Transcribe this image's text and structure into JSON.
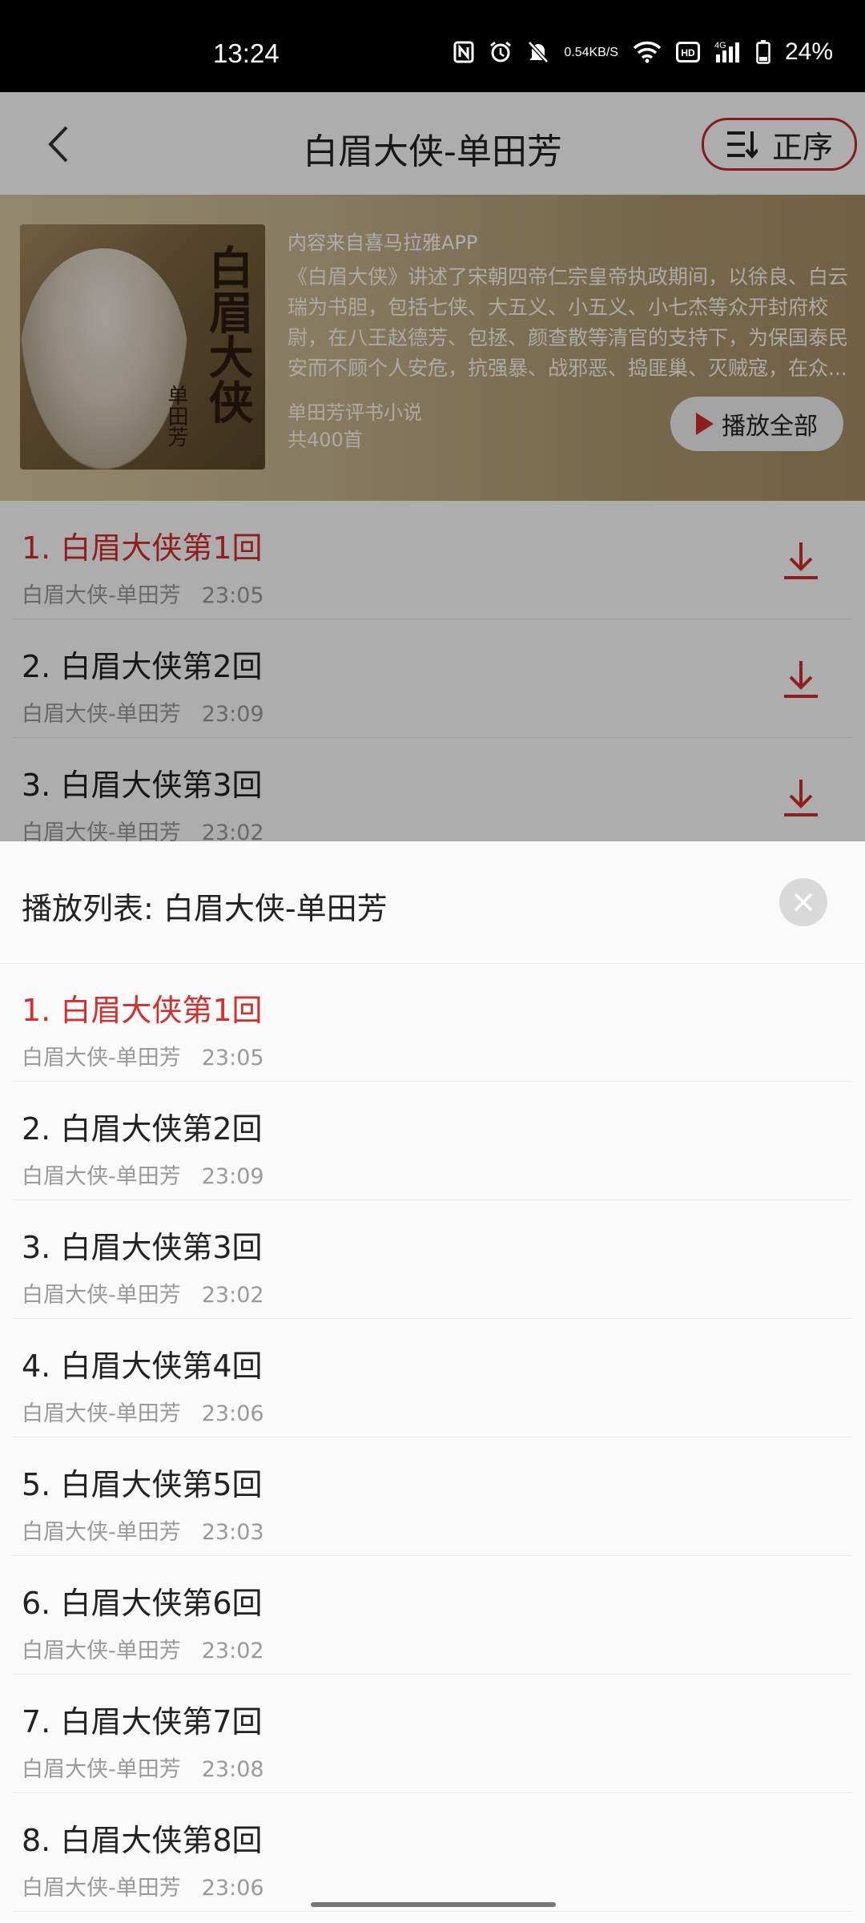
{
  "status_bar": {
    "time": "13:24",
    "net_speed_top": "0.54",
    "net_speed_bottom": "KB/S",
    "network": "4G",
    "battery": "24%"
  },
  "header": {
    "title": "白眉大侠-单田芳",
    "order_label": "正序"
  },
  "album": {
    "source": "内容来自喜马拉雅APP",
    "description": "《白眉大侠》讲述了宋朝四帝仁宗皇帝执政期间，以徐良、白云瑞为书胆，包括七侠、大五义、小五义、小七杰等众开封府校尉，在八王赵德芳、包拯、颜查散等清官的支持下，为保国泰民安而不顾个人安危，抗强暴、战邪恶、捣匪巢、灭贼寇，在众...",
    "category": "单田芳评书小说",
    "count": "共400首",
    "play_all_label": "播放全部",
    "cover_title": "白眉大侠",
    "cover_author": "单田芳"
  },
  "tracks": [
    {
      "title": "1. 白眉大侠第1回",
      "album": "白眉大侠-单田芳",
      "duration": "23:05"
    },
    {
      "title": "2. 白眉大侠第2回",
      "album": "白眉大侠-单田芳",
      "duration": "23:09"
    },
    {
      "title": "3. 白眉大侠第3回",
      "album": "白眉大侠-单田芳",
      "duration": "23:02"
    }
  ],
  "playlist": {
    "title": "播放列表:  白眉大侠-单田芳",
    "items": [
      {
        "title": "1. 白眉大侠第1回",
        "album": "白眉大侠-单田芳",
        "duration": "23:05"
      },
      {
        "title": "2. 白眉大侠第2回",
        "album": "白眉大侠-单田芳",
        "duration": "23:09"
      },
      {
        "title": "3. 白眉大侠第3回",
        "album": "白眉大侠-单田芳",
        "duration": "23:02"
      },
      {
        "title": "4. 白眉大侠第4回",
        "album": "白眉大侠-单田芳",
        "duration": "23:06"
      },
      {
        "title": "5. 白眉大侠第5回",
        "album": "白眉大侠-单田芳",
        "duration": "23:03"
      },
      {
        "title": "6. 白眉大侠第6回",
        "album": "白眉大侠-单田芳",
        "duration": "23:02"
      },
      {
        "title": "7. 白眉大侠第7回",
        "album": "白眉大侠-单田芳",
        "duration": "23:08"
      },
      {
        "title": "8. 白眉大侠第8回",
        "album": "白眉大侠-单田芳",
        "duration": "23:06"
      }
    ]
  },
  "colors": {
    "accent": "#d32f2f",
    "sheet_bg": "#fafafa"
  }
}
